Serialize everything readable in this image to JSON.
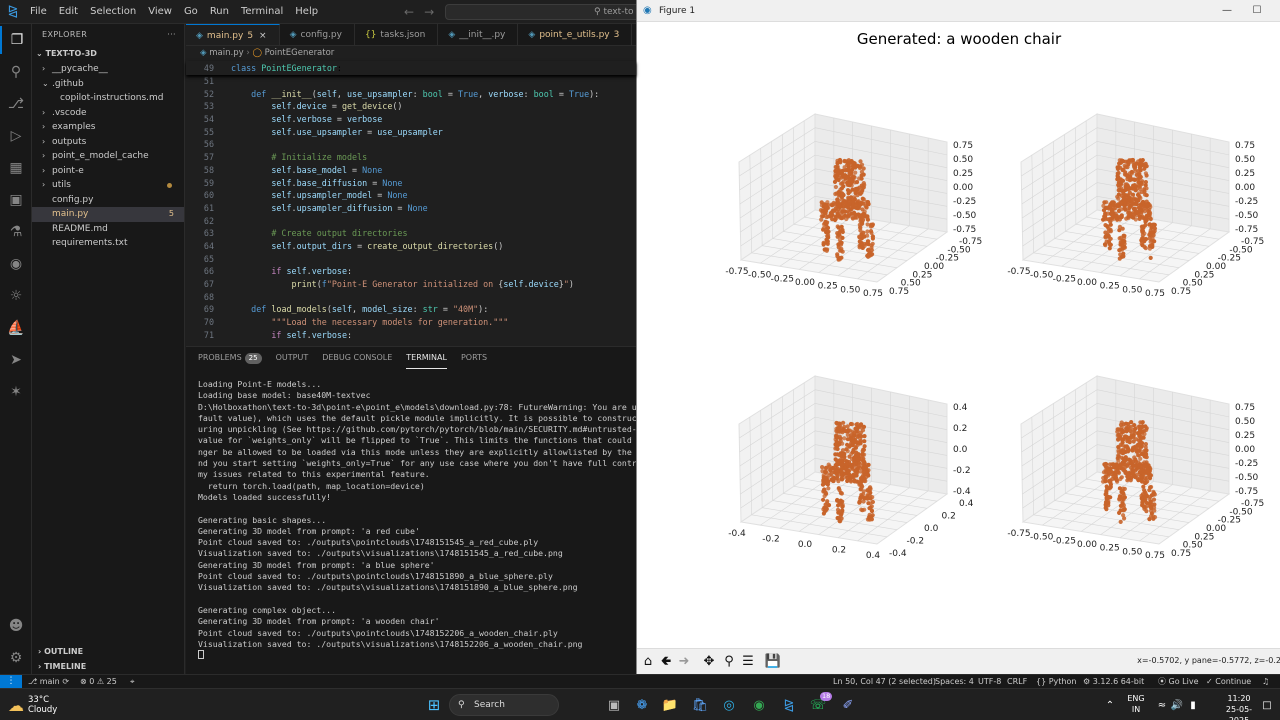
{
  "vscode": {
    "menu": [
      "File",
      "Edit",
      "Selection",
      "View",
      "Go",
      "Run",
      "Terminal",
      "Help"
    ],
    "command_center": "text-to",
    "explorer": {
      "header": "EXPLORER",
      "more": "···",
      "root": "TEXT-TO-3D",
      "items": [
        {
          "label": "__pycache__",
          "indent": 1,
          "folder": true,
          "open": false
        },
        {
          "label": ".github",
          "indent": 1,
          "folder": true,
          "open": true
        },
        {
          "label": "copilot-instructions.md",
          "indent": 2,
          "folder": false
        },
        {
          "label": ".vscode",
          "indent": 1,
          "folder": true,
          "open": false
        },
        {
          "label": "examples",
          "indent": 1,
          "folder": true,
          "open": false
        },
        {
          "label": "outputs",
          "indent": 1,
          "folder": true,
          "open": false
        },
        {
          "label": "point_e_model_cache",
          "indent": 1,
          "folder": true,
          "open": false
        },
        {
          "label": "point-e",
          "indent": 1,
          "folder": true,
          "open": false
        },
        {
          "label": "utils",
          "indent": 1,
          "folder": true,
          "open": false,
          "dot": true
        },
        {
          "label": "config.py",
          "indent": 1,
          "folder": false
        },
        {
          "label": "main.py",
          "indent": 1,
          "folder": false,
          "selected": true,
          "badge": "5"
        },
        {
          "label": "README.md",
          "indent": 1,
          "folder": false
        },
        {
          "label": "requirements.txt",
          "indent": 1,
          "folder": false
        }
      ],
      "outline": "OUTLINE",
      "timeline": "TIMELINE"
    },
    "tabs": [
      {
        "label": "main.py",
        "suffix": "5",
        "active": true,
        "close": "×"
      },
      {
        "label": "config.py"
      },
      {
        "label": "tasks.json"
      },
      {
        "label": "__init__.py"
      },
      {
        "label": "point_e_utils.py",
        "suffix": "3"
      },
      {
        "label": "p"
      }
    ],
    "breadcrumb": [
      "main.py",
      "PointEGenerator"
    ],
    "sticky": {
      "ln": "49",
      "text": "class PointEGenerator:"
    },
    "code": [
      {
        "ln": "51",
        "html": ""
      },
      {
        "ln": "52",
        "html": "    <span class='kw'>def</span> <span class='fn'>__init__</span>(<span class='var'>self</span>, <span class='var'>use_upsampler</span>: <span class='cls'>bool</span> = <span class='kw'>True</span>, <span class='var'>verbose</span>: <span class='cls'>bool</span> = <span class='kw'>True</span>):"
      },
      {
        "ln": "53",
        "html": "        <span class='var'>self</span>.<span class='var'>device</span> = <span class='fn'>get_device</span>()"
      },
      {
        "ln": "54",
        "html": "        <span class='var'>self</span>.<span class='var'>verbose</span> = <span class='var'>verbose</span>"
      },
      {
        "ln": "55",
        "html": "        <span class='var'>self</span>.<span class='var'>use_upsampler</span> = <span class='var'>use_upsampler</span>"
      },
      {
        "ln": "56",
        "html": ""
      },
      {
        "ln": "57",
        "html": "        <span class='cmt'># Initialize models</span>"
      },
      {
        "ln": "58",
        "html": "        <span class='var'>self</span>.<span class='var'>base_model</span> = <span class='kw'>None</span>"
      },
      {
        "ln": "59",
        "html": "        <span class='var'>self</span>.<span class='var'>base_diffusion</span> = <span class='kw'>None</span>"
      },
      {
        "ln": "60",
        "html": "        <span class='var'>self</span>.<span class='var'>upsampler_model</span> = <span class='kw'>None</span>"
      },
      {
        "ln": "61",
        "html": "        <span class='var'>self</span>.<span class='var'>upsampler_diffusion</span> = <span class='kw'>None</span>"
      },
      {
        "ln": "62",
        "html": ""
      },
      {
        "ln": "63",
        "html": "        <span class='cmt'># Create output directories</span>"
      },
      {
        "ln": "64",
        "html": "        <span class='var'>self</span>.<span class='var'>output_dirs</span> = <span class='fn'>create_output_directories</span>()"
      },
      {
        "ln": "65",
        "html": ""
      },
      {
        "ln": "66",
        "html": "        <span class='kw2'>if</span> <span class='var'>self</span>.<span class='var'>verbose</span>:"
      },
      {
        "ln": "67",
        "html": "            <span class='fn'>print</span>(<span class='kw'>f</span><span class='str'>\"Point-E Generator initialized on </span>{<span class='var'>self</span>.<span class='var'>device</span>}<span class='str'>\"</span>)"
      },
      {
        "ln": "68",
        "html": ""
      },
      {
        "ln": "69",
        "html": "    <span class='kw'>def</span> <span class='fn'>load_models</span>(<span class='var'>self</span>, <span class='var'>model_size</span>: <span class='cls'>str</span> = <span class='str'>\"40M\"</span>):"
      },
      {
        "ln": "70",
        "html": "        <span class='str'>\"\"\"Load the necessary models for generation.\"\"\"</span>"
      },
      {
        "ln": "71",
        "html": "        <span class='kw2'>if</span> <span class='var'>self</span>.<span class='var'>verbose</span>:"
      }
    ],
    "panel": {
      "tabs": [
        "PROBLEMS",
        "OUTPUT",
        "DEBUG CONSOLE",
        "TERMINAL",
        "PORTS"
      ],
      "problems_count": "25",
      "active": "TERMINAL",
      "terminal": [
        "Loading Point-E models...",
        "Loading base model: base40M-textvec",
        "D:\\Holboxathon\\text-to-3d\\point-e\\point_e\\models\\download.py:78: FutureWarning: You are using",
        "fault value), which uses the default pickle module implicitly. It is possible to construct ma",
        "uring unpickling (See https://github.com/pytorch/pytorch/blob/main/SECURITY.md#untrusted-mode",
        "value for `weights_only` will be flipped to `True`. This limits the functions that could be ex",
        "nger be allowed to be loaded via this mode unless they are explicitly allowlisted by the user",
        "nd you start setting `weights_only=True` for any use case where you don't have full control o",
        "my issues related to this experimental feature.",
        "  return torch.load(path, map_location=device)",
        "Models loaded successfully!",
        "",
        "Generating basic shapes...",
        "Generating 3D model from prompt: 'a red cube'",
        "Point cloud saved to: ./outputs\\pointclouds\\1748151545_a_red_cube.ply",
        "Visualization saved to: ./outputs\\visualizations\\1748151545_a_red_cube.png",
        "Generating 3D model from prompt: 'a blue sphere'",
        "Point cloud saved to: ./outputs\\pointclouds\\1748151890_a_blue_sphere.ply",
        "Visualization saved to: ./outputs\\visualizations\\1748151890_a_blue_sphere.png",
        "",
        "Generating complex object...",
        "Generating 3D model from prompt: 'a wooden chair'",
        "Point cloud saved to: ./outputs\\pointclouds\\1748152206_a_wooden_chair.ply",
        "Visualization saved to: ./outputs\\visualizations\\1748152206_a_wooden_chair.png"
      ]
    },
    "status": {
      "branch": "main",
      "errors": "0",
      "warnings": "25",
      "cursor": "Ln 50, Col 47 (2 selected)",
      "spaces": "Spaces: 4",
      "encoding": "UTF-8",
      "eol": "CRLF",
      "language": "Python",
      "interpreter": "3.12.6 64-bit",
      "golive": "Go Live",
      "continue": "Continue"
    }
  },
  "figure": {
    "window_title": "Figure 1",
    "title": "Generated: a wooden chair",
    "coords": "x=-0.5702, y pane=-0.5772, z=-0.2",
    "point_color": "#c8642a",
    "subplots": [
      {
        "name": "top-left",
        "z_ticks": [
          "0.75",
          "0.50",
          "0.25",
          "0.00",
          "-0.25",
          "-0.50",
          "-0.75"
        ],
        "x_ticks": [
          "-0.75",
          "-0.50",
          "-0.25",
          "0.00",
          "0.25",
          "0.50",
          "0.75"
        ],
        "y_ticks": [
          "0.75",
          "0.50",
          "0.25",
          "0.00",
          "-0.25",
          "-0.50",
          "-0.75"
        ]
      },
      {
        "name": "top-right",
        "z_ticks": [
          "0.75",
          "0.50",
          "0.25",
          "0.00",
          "-0.25",
          "-0.50",
          "-0.75"
        ],
        "x_ticks": [
          "-0.75",
          "-0.50",
          "-0.25",
          "0.00",
          "0.25",
          "0.50",
          "0.75"
        ],
        "y_ticks": [
          "0.75",
          "0.50",
          "0.25",
          "0.00",
          "-0.25",
          "-0.50",
          "-0.75"
        ]
      },
      {
        "name": "bottom-left",
        "z_ticks": [
          "0.4",
          "0.2",
          "0.0",
          "-0.2",
          "-0.4"
        ],
        "x_ticks": [
          "-0.4",
          "-0.2",
          "0.0",
          "0.2",
          "0.4"
        ],
        "y_ticks": [
          "-0.4",
          "-0.2",
          "0.0",
          "0.2",
          "0.4"
        ]
      },
      {
        "name": "bottom-right",
        "z_ticks": [
          "0.75",
          "0.50",
          "0.25",
          "0.00",
          "-0.25",
          "-0.50",
          "-0.75"
        ],
        "x_ticks": [
          "-0.75",
          "-0.50",
          "-0.25",
          "0.00",
          "0.25",
          "0.50",
          "0.75"
        ],
        "y_ticks": [
          "0.75",
          "0.50",
          "0.25",
          "0.00",
          "-0.25",
          "-0.50",
          "-0.75"
        ]
      }
    ]
  },
  "taskbar": {
    "weather_temp": "33°C",
    "weather_desc": "Cloudy",
    "search": "Search",
    "whatsapp_badge": "18",
    "lang_top": "ENG",
    "lang_bottom": "IN",
    "time": "11:20",
    "date": "25-05-2025"
  }
}
